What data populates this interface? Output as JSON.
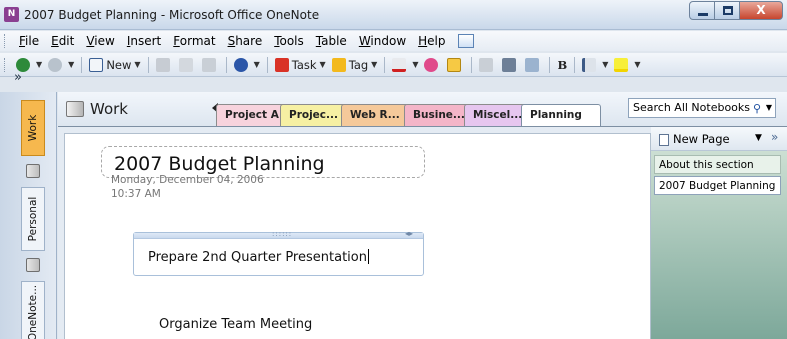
{
  "window": {
    "title": "2007 Budget Planning - Microsoft Office OneNote",
    "close_glyph": "X"
  },
  "menu": [
    "File",
    "Edit",
    "View",
    "Insert",
    "Format",
    "Share",
    "Tools",
    "Table",
    "Window",
    "Help"
  ],
  "toolbar": {
    "new_label": "New",
    "task_label": "Task",
    "tag_label": "Tag",
    "bold_label": "B"
  },
  "notebook_strip": {
    "collapse_glyph": "»",
    "notebooks": [
      "Work",
      "Personal",
      "OneNote..."
    ]
  },
  "header": {
    "notebook_title": "Work",
    "section_tabs": [
      "Project A",
      "Projec...",
      "Web R...",
      "Busine...",
      "Miscel...",
      "Planning"
    ],
    "active_tab": "Planning",
    "search_placeholder": "Search All Notebooks"
  },
  "page": {
    "title": "2007 Budget Planning",
    "date": "Monday, December 04, 2006",
    "time": "10:37 AM",
    "outline_text": "Prepare 2nd Quarter Presentation",
    "note_text": "Organize Team Meeting"
  },
  "page_list": {
    "new_page_label": "New Page",
    "more_glyph": "»",
    "pages": [
      "About this section",
      "2007 Budget Planning"
    ],
    "active_page": "2007 Budget Planning"
  },
  "colors": {
    "tab_project_a": "#f7d3dd",
    "tab_project_b": "#f6f0a3",
    "tab_web": "#f5c99a",
    "tab_business": "#f4b5c8",
    "tab_misc": "#e6c6ef",
    "tab_active": "#ffffff",
    "notebook_active": "#f6b84e"
  }
}
